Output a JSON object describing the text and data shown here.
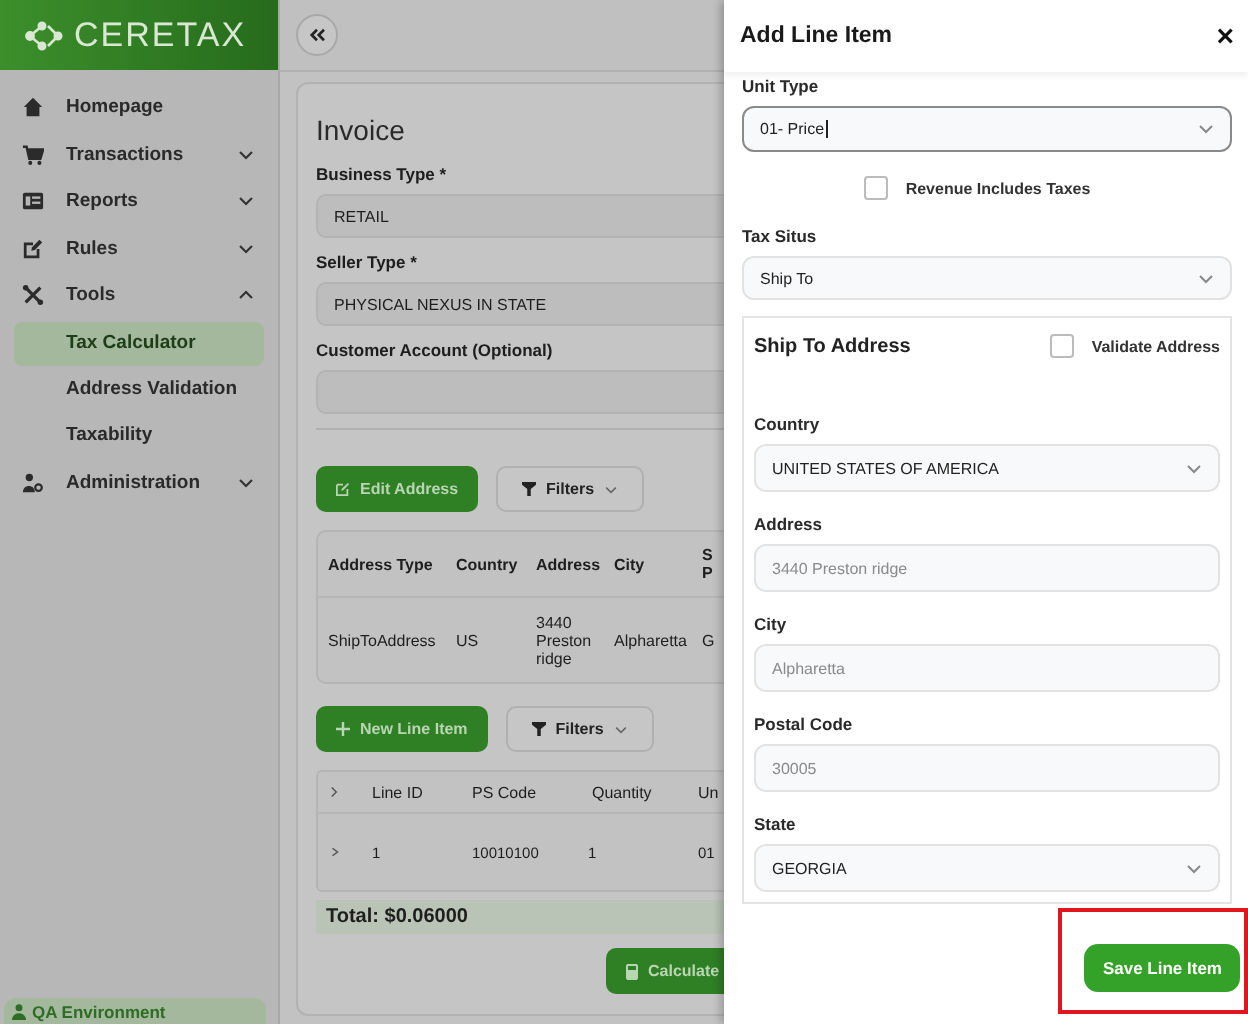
{
  "logo": {
    "text": "CERETAX"
  },
  "sidebar": {
    "items": [
      {
        "label": "Homepage"
      },
      {
        "label": "Transactions",
        "expanded": false
      },
      {
        "label": "Reports",
        "expanded": false
      },
      {
        "label": "Rules",
        "expanded": false
      },
      {
        "label": "Tools",
        "expanded": true,
        "children": [
          {
            "label": "Tax Calculator",
            "selected": true
          },
          {
            "label": "Address Validation",
            "selected": false
          },
          {
            "label": "Taxability",
            "selected": false
          }
        ]
      },
      {
        "label": "Administration",
        "expanded": false
      }
    ],
    "environment": "QA Environment"
  },
  "invoice": {
    "title": "Invoice",
    "fields": [
      {
        "label": "Business Type *",
        "value": "RETAIL"
      },
      {
        "label": "Seller Type *",
        "value": "PHYSICAL NEXUS IN STATE"
      },
      {
        "label": "Customer Account (Optional)"
      }
    ],
    "address_actions": [
      {
        "kind": "primary",
        "label": "Edit Address"
      },
      {
        "kind": "filter",
        "label": "Filters"
      }
    ],
    "address_table": {
      "columns": [
        "Address Type",
        "Country",
        "Address",
        "City",
        "S P"
      ],
      "rows": [
        [
          "ShipToAddress",
          "US",
          "3440 Preston ridge",
          "Alpharetta",
          "G"
        ]
      ]
    },
    "line_actions": [
      {
        "kind": "primary",
        "label": "New Line Item"
      },
      {
        "kind": "filter",
        "label": "Filters"
      }
    ],
    "line_table": {
      "columns": [
        "Line ID",
        "PS Code",
        "Quantity",
        "Un"
      ],
      "rows": [
        {
          "expanded": false,
          "cells": [
            "1",
            "10010100",
            "1",
            "01"
          ]
        }
      ]
    },
    "total": "Total: $0.06000",
    "calculate_button": "Calculate"
  },
  "drawer": {
    "title": "Add Line Item",
    "close": "×",
    "unit_type": {
      "label": "Unit Type",
      "value": "01- Price",
      "focused": true
    },
    "revenue_includes_taxes": {
      "label": "Revenue Includes Taxes",
      "checked": false
    },
    "tax_situs": {
      "label": "Tax Situs",
      "value": "Ship To"
    },
    "ship_to": {
      "title": "Ship To Address",
      "validate": {
        "label": "Validate Address",
        "checked": false
      },
      "fields": [
        {
          "kind": "select",
          "label": "Country",
          "value": "UNITED STATES OF AMERICA"
        },
        {
          "kind": "input",
          "label": "Address",
          "value": "3440 Preston ridge",
          "disabled": true
        },
        {
          "kind": "input",
          "label": "City",
          "value": "Alpharetta",
          "disabled": true
        },
        {
          "kind": "input",
          "label": "Postal Code",
          "value": "30005",
          "disabled": true
        },
        {
          "kind": "select",
          "label": "State",
          "value": "GEORGIA"
        }
      ]
    },
    "save_button": {
      "label": "Save Line Item",
      "highlighted": true
    }
  }
}
